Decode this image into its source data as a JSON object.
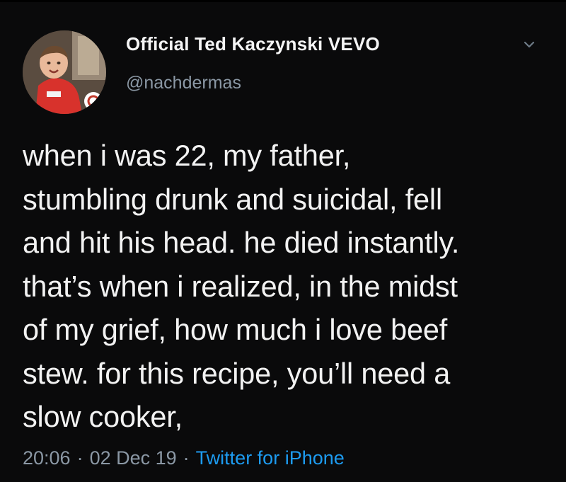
{
  "tweet": {
    "display_name": "Official Ted Kaczynski VEVO",
    "handle": "@nachdermas",
    "text": "when i was 22, my father,\nstumbling drunk and suicidal, fell\nand hit his head. he died instantly.\nthat’s when i realized, in the midst\nof my grief, how much i love beef\nstew. for this recipe, you’ll need a\nslow cooker,",
    "time": "20:06",
    "date": "02 Dec 19",
    "separator": "·",
    "source": "Twitter for iPhone"
  },
  "icons": {
    "avatar": "profile-photo-avatar",
    "menu": "chevron-down-icon"
  },
  "colors": {
    "background": "#0a0a0b",
    "text": "#f2f2f2",
    "secondary_text": "#8b98a5",
    "link": "#1d9bf0"
  }
}
